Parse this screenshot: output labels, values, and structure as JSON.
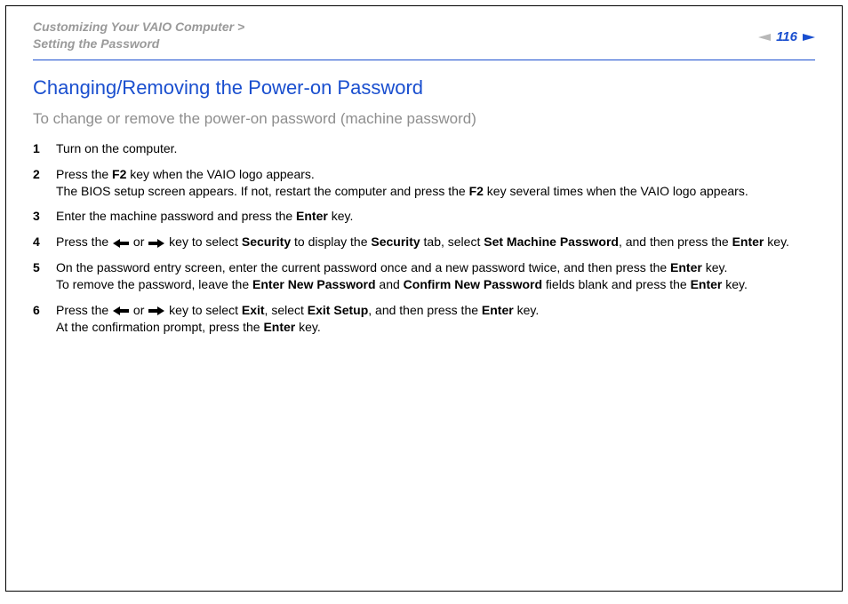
{
  "header": {
    "breadcrumb_line1": "Customizing Your VAIO Computer >",
    "breadcrumb_line2": "Setting the Password",
    "page_number": "116"
  },
  "content": {
    "title": "Changing/Removing the Power-on Password",
    "subtitle": "To change or remove the power-on password (machine password)",
    "steps": [
      {
        "num": "1",
        "html": "Turn on the computer."
      },
      {
        "num": "2",
        "html": "Press the <b>F2</b> key when the VAIO logo appears.<br>The BIOS setup screen appears. If not, restart the computer and press the <b>F2</b> key several times when the VAIO logo appears."
      },
      {
        "num": "3",
        "html": "Enter the machine password and press the <b>Enter</b> key."
      },
      {
        "num": "4",
        "html": "Press the {ARROW_L} or {ARROW_R} key to select <b>Security</b> to display the <b>Security</b> tab, select <b>Set Machine Password</b>, and then press the <b>Enter</b> key."
      },
      {
        "num": "5",
        "html": "On the password entry screen, enter the current password once and a new password twice, and then press the <b>Enter</b> key.<br>To remove the password, leave the <b>Enter New Password</b> and <b>Confirm New Password</b> fields blank and press the <b>Enter</b> key."
      },
      {
        "num": "6",
        "html": "Press the {ARROW_L} or {ARROW_R} key to select <b>Exit</b>, select <b>Exit Setup</b>, and then press the <b>Enter</b> key.<br>At the confirmation prompt, press the <b>Enter</b> key."
      }
    ]
  }
}
